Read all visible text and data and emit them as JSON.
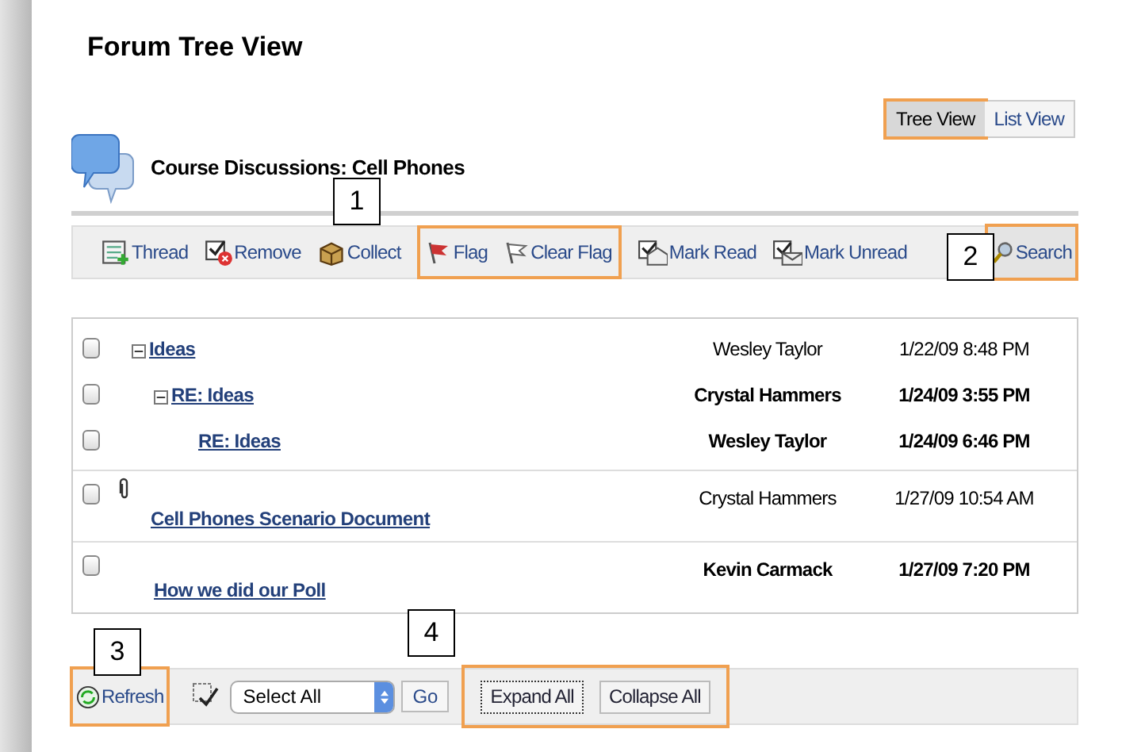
{
  "page_title": "Forum Tree View",
  "header": {
    "title": "Course Discussions: Cell Phones"
  },
  "view_tabs": [
    {
      "label": "Tree View",
      "selected": true,
      "highlighted": true
    },
    {
      "label": "List View",
      "selected": false,
      "highlighted": false
    }
  ],
  "toolbar": {
    "groups": [
      {
        "highlighted": false,
        "items": [
          {
            "label": "Thread",
            "kind": "thread"
          },
          {
            "label": "Remove",
            "kind": "remove"
          },
          {
            "label": "Collect",
            "kind": "collect"
          }
        ]
      },
      {
        "highlighted": true,
        "items": [
          {
            "label": "Flag",
            "kind": "flag"
          },
          {
            "label": "Clear Flag",
            "kind": "clearflag"
          }
        ]
      },
      {
        "highlighted": false,
        "items": [
          {
            "label": "Mark Read",
            "kind": "markread"
          },
          {
            "label": "Mark Unread",
            "kind": "markunread"
          }
        ]
      }
    ],
    "search": {
      "label": "Search",
      "highlighted": true
    }
  },
  "threads": [
    {
      "title": "Ideas",
      "author": "Wesley Taylor",
      "date": "1/22/09 8:48 PM",
      "unread": false,
      "checked": false,
      "expanded": true,
      "children": [
        {
          "title": "RE: Ideas",
          "author": "Crystal Hammers",
          "date": "1/24/09 3:55 PM",
          "unread": true,
          "checked": false,
          "expanded": true,
          "children": [
            {
              "title": "RE: Ideas",
              "author": "Wesley Taylor",
              "date": "1/24/09 6:46 PM",
              "unread": true,
              "checked": false
            }
          ]
        }
      ]
    },
    {
      "title": "Cell Phones Scenario Document",
      "author": "Crystal Hammers",
      "date": "1/27/09 10:54 AM",
      "unread": false,
      "checked": false,
      "attachment": true
    },
    {
      "title": "How we did our Poll",
      "author": "Kevin Carmack",
      "date": "1/27/09 7:20 PM",
      "unread": true,
      "checked": false
    }
  ],
  "bottom_bar": {
    "refresh": {
      "label": "Refresh",
      "highlighted": true
    },
    "select": {
      "value": "Select All"
    },
    "go": "Go",
    "expand_group": {
      "highlighted": true,
      "buttons": [
        {
          "label": "Expand All",
          "focused": true
        },
        {
          "label": "Collapse All",
          "focused": false
        }
      ]
    }
  },
  "callouts": [
    "1",
    "2",
    "3",
    "4"
  ]
}
